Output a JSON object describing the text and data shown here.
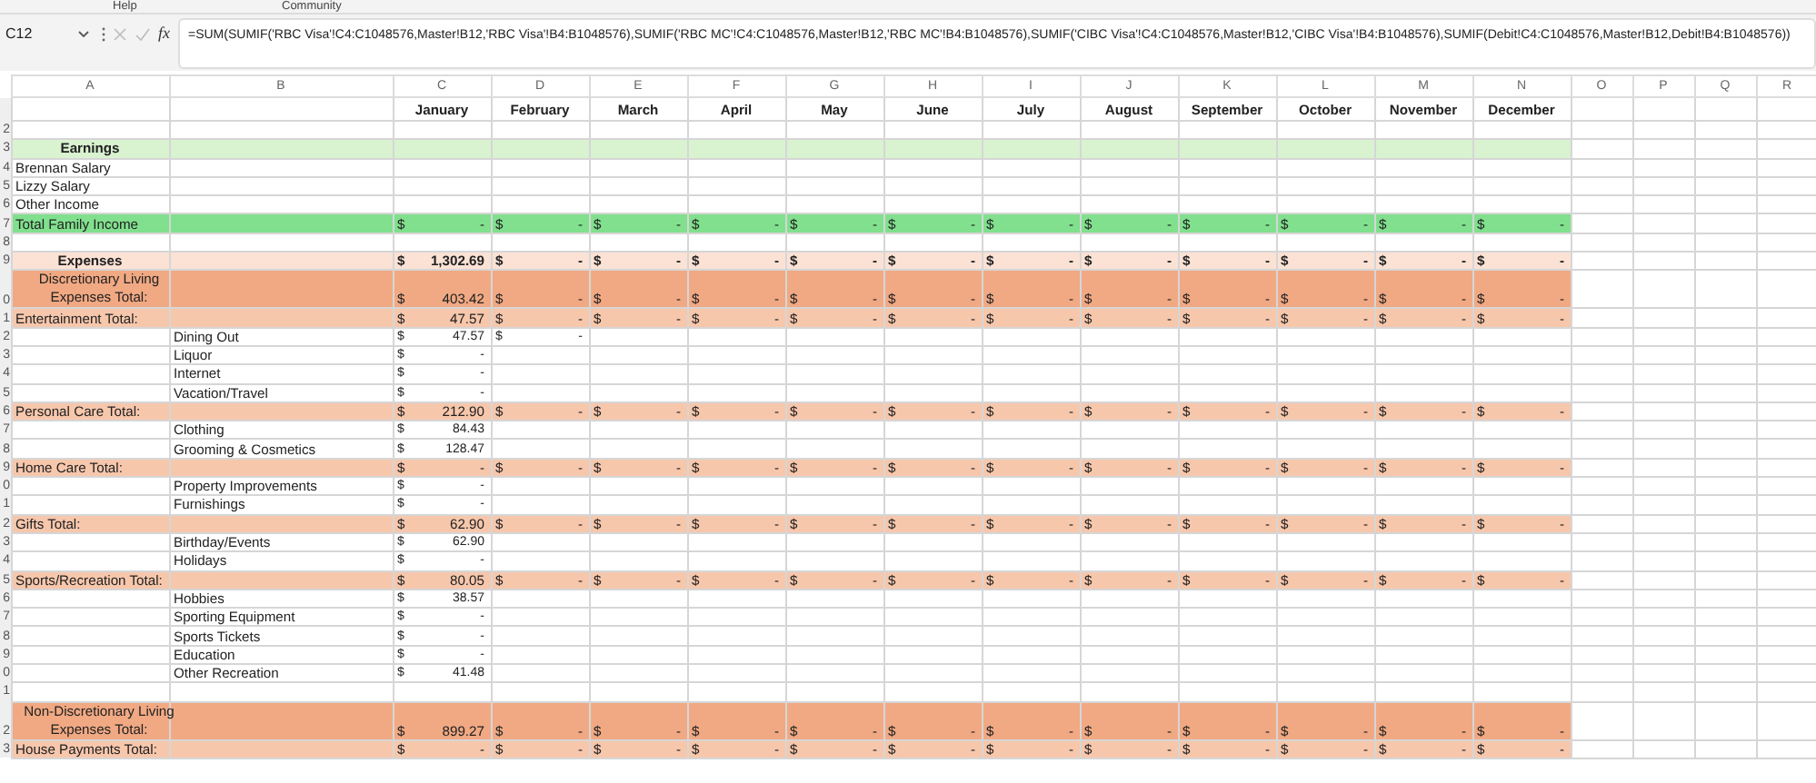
{
  "ribbon_tabs": [
    "Help",
    "Community"
  ],
  "formula_bar": {
    "name_box": "C12",
    "function_label": "fx",
    "formula": "=SUM(SUMIF('RBC Visa'!C4:C1048576,Master!B12,'RBC Visa'!B4:B1048576),SUMIF('RBC MC'!C4:C1048576,Master!B12,'RBC MC'!B4:B1048576),SUMIF('CIBC Visa'!C4:C1048576,Master!B12,'CIBC Visa'!B4:B1048576),SUMIF(Debit!C4:C1048576,Master!B12,Debit!B4:B1048576))"
  },
  "column_headers": [
    "A",
    "B",
    "C",
    "D",
    "E",
    "F",
    "G",
    "H",
    "I",
    "J",
    "K",
    "L",
    "M",
    "N",
    "O",
    "P",
    "Q",
    "R"
  ],
  "month_row": {
    "months": [
      "January",
      "February",
      "March",
      "April",
      "May",
      "June",
      "July",
      "August",
      "September",
      "October",
      "November",
      "December"
    ]
  },
  "rows": [
    {
      "row_number": "2",
      "kind": "blank"
    },
    {
      "row_number": "3",
      "kind": "earnings-header",
      "label": "Earnings"
    },
    {
      "row_number": "4",
      "kind": "income-item",
      "label": "Brennan Salary"
    },
    {
      "row_number": "5",
      "kind": "income-item",
      "label": "Lizzy Salary"
    },
    {
      "row_number": "6",
      "kind": "income-item",
      "label": "Other Income"
    },
    {
      "row_number": "7",
      "kind": "income-total",
      "label": "Total Family Income",
      "values": [
        [
          "$",
          "-"
        ],
        [
          "$",
          "-"
        ],
        [
          "$",
          "-"
        ],
        [
          "$",
          "-"
        ],
        [
          "$",
          "-"
        ],
        [
          "$",
          "-"
        ],
        [
          "$",
          "-"
        ],
        [
          "$",
          "-"
        ],
        [
          "$",
          "-"
        ],
        [
          "$",
          "-"
        ],
        [
          "$",
          "-"
        ],
        [
          "$",
          "-"
        ]
      ]
    },
    {
      "row_number": "8",
      "kind": "blank"
    },
    {
      "row_number": "9",
      "kind": "expenses-header",
      "label": "Expenses",
      "values": [
        [
          "$",
          "1,302.69"
        ],
        [
          "$",
          "-"
        ],
        [
          "$",
          "-"
        ],
        [
          "$",
          "-"
        ],
        [
          "$",
          "-"
        ],
        [
          "$",
          "-"
        ],
        [
          "$",
          "-"
        ],
        [
          "$",
          "-"
        ],
        [
          "$",
          "-"
        ],
        [
          "$",
          "-"
        ],
        [
          "$",
          "-"
        ],
        [
          "$",
          "-"
        ]
      ]
    },
    {
      "row_number": "0",
      "kind": "group-total",
      "label": "Discretionary Living Expenses Total:",
      "values": [
        [
          "$",
          "403.42"
        ],
        [
          "$",
          "-"
        ],
        [
          "$",
          "-"
        ],
        [
          "$",
          "-"
        ],
        [
          "$",
          "-"
        ],
        [
          "$",
          "-"
        ],
        [
          "$",
          "-"
        ],
        [
          "$",
          "-"
        ],
        [
          "$",
          "-"
        ],
        [
          "$",
          "-"
        ],
        [
          "$",
          "-"
        ],
        [
          "$",
          "-"
        ]
      ]
    },
    {
      "row_number": "1",
      "kind": "category-total",
      "label": "Entertainment Total:",
      "values": [
        [
          "$",
          "47.57"
        ],
        [
          "$",
          "-"
        ],
        [
          "$",
          "-"
        ],
        [
          "$",
          "-"
        ],
        [
          "$",
          "-"
        ],
        [
          "$",
          "-"
        ],
        [
          "$",
          "-"
        ],
        [
          "$",
          "-"
        ],
        [
          "$",
          "-"
        ],
        [
          "$",
          "-"
        ],
        [
          "$",
          "-"
        ],
        [
          "$",
          "-"
        ]
      ]
    },
    {
      "row_number": "2",
      "kind": "item",
      "label": "Dining Out",
      "values": [
        [
          "$",
          "47.57"
        ],
        [
          "$",
          "-"
        ]
      ]
    },
    {
      "row_number": "3",
      "kind": "item",
      "label": "Liquor",
      "values": [
        [
          "$",
          "-"
        ]
      ]
    },
    {
      "row_number": "4",
      "kind": "item",
      "label": "Internet",
      "values": [
        [
          "$",
          "-"
        ]
      ]
    },
    {
      "row_number": "5",
      "kind": "item",
      "label": "Vacation/Travel",
      "values": [
        [
          "$",
          "-"
        ]
      ]
    },
    {
      "row_number": "6",
      "kind": "category-total",
      "label": "Personal Care Total:",
      "values": [
        [
          "$",
          "212.90"
        ],
        [
          "$",
          "-"
        ],
        [
          "$",
          "-"
        ],
        [
          "$",
          "-"
        ],
        [
          "$",
          "-"
        ],
        [
          "$",
          "-"
        ],
        [
          "$",
          "-"
        ],
        [
          "$",
          "-"
        ],
        [
          "$",
          "-"
        ],
        [
          "$",
          "-"
        ],
        [
          "$",
          "-"
        ],
        [
          "$",
          "-"
        ]
      ]
    },
    {
      "row_number": "7",
      "kind": "item",
      "label": "Clothing",
      "values": [
        [
          "$",
          "84.43"
        ]
      ]
    },
    {
      "row_number": "8",
      "kind": "item",
      "label": "Grooming & Cosmetics",
      "values": [
        [
          "$",
          "128.47"
        ]
      ]
    },
    {
      "row_number": "9",
      "kind": "category-total",
      "label": "Home Care Total:",
      "values": [
        [
          "$",
          "-"
        ],
        [
          "$",
          "-"
        ],
        [
          "$",
          "-"
        ],
        [
          "$",
          "-"
        ],
        [
          "$",
          "-"
        ],
        [
          "$",
          "-"
        ],
        [
          "$",
          "-"
        ],
        [
          "$",
          "-"
        ],
        [
          "$",
          "-"
        ],
        [
          "$",
          "-"
        ],
        [
          "$",
          "-"
        ],
        [
          "$",
          "-"
        ]
      ]
    },
    {
      "row_number": "0",
      "kind": "item",
      "label": "Property Improvements",
      "values": [
        [
          "$",
          "-"
        ]
      ]
    },
    {
      "row_number": "1",
      "kind": "item",
      "label": "Furnishings",
      "values": [
        [
          "$",
          "-"
        ]
      ]
    },
    {
      "row_number": "2",
      "kind": "category-total",
      "label": "Gifts Total:",
      "values": [
        [
          "$",
          "62.90"
        ],
        [
          "$",
          "-"
        ],
        [
          "$",
          "-"
        ],
        [
          "$",
          "-"
        ],
        [
          "$",
          "-"
        ],
        [
          "$",
          "-"
        ],
        [
          "$",
          "-"
        ],
        [
          "$",
          "-"
        ],
        [
          "$",
          "-"
        ],
        [
          "$",
          "-"
        ],
        [
          "$",
          "-"
        ],
        [
          "$",
          "-"
        ]
      ]
    },
    {
      "row_number": "3",
      "kind": "item",
      "label": "Birthday/Events",
      "values": [
        [
          "$",
          "62.90"
        ]
      ]
    },
    {
      "row_number": "4",
      "kind": "item",
      "label": "Holidays",
      "values": [
        [
          "$",
          "-"
        ]
      ]
    },
    {
      "row_number": "5",
      "kind": "category-total",
      "label": "Sports/Recreation Total:",
      "values": [
        [
          "$",
          "80.05"
        ],
        [
          "$",
          "-"
        ],
        [
          "$",
          "-"
        ],
        [
          "$",
          "-"
        ],
        [
          "$",
          "-"
        ],
        [
          "$",
          "-"
        ],
        [
          "$",
          "-"
        ],
        [
          "$",
          "-"
        ],
        [
          "$",
          "-"
        ],
        [
          "$",
          "-"
        ],
        [
          "$",
          "-"
        ],
        [
          "$",
          "-"
        ]
      ]
    },
    {
      "row_number": "6",
      "kind": "item",
      "label": "Hobbies",
      "values": [
        [
          "$",
          "38.57"
        ]
      ]
    },
    {
      "row_number": "7",
      "kind": "item",
      "label": "Sporting Equipment",
      "values": [
        [
          "$",
          "-"
        ]
      ]
    },
    {
      "row_number": "8",
      "kind": "item",
      "label": "Sports Tickets",
      "values": [
        [
          "$",
          "-"
        ]
      ]
    },
    {
      "row_number": "9",
      "kind": "item",
      "label": "Education",
      "values": [
        [
          "$",
          "-"
        ]
      ]
    },
    {
      "row_number": "0",
      "kind": "item",
      "label": "Other Recreation",
      "values": [
        [
          "$",
          "41.48"
        ]
      ]
    },
    {
      "row_number": "1",
      "kind": "blank"
    },
    {
      "row_number": "2",
      "kind": "group-total",
      "label": "Non-Discretionary Living Expenses Total:",
      "values": [
        [
          "$",
          "899.27"
        ],
        [
          "$",
          "-"
        ],
        [
          "$",
          "-"
        ],
        [
          "$",
          "-"
        ],
        [
          "$",
          "-"
        ],
        [
          "$",
          "-"
        ],
        [
          "$",
          "-"
        ],
        [
          "$",
          "-"
        ],
        [
          "$",
          "-"
        ],
        [
          "$",
          "-"
        ],
        [
          "$",
          "-"
        ],
        [
          "$",
          "-"
        ]
      ]
    },
    {
      "row_number": "3",
      "kind": "category-total",
      "label": "House Payments Total:",
      "values": [
        [
          "$",
          "-"
        ],
        [
          "$",
          "-"
        ],
        [
          "$",
          "-"
        ],
        [
          "$",
          "-"
        ],
        [
          "$",
          "-"
        ],
        [
          "$",
          "-"
        ],
        [
          "$",
          "-"
        ],
        [
          "$",
          "-"
        ],
        [
          "$",
          "-"
        ],
        [
          "$",
          "-"
        ],
        [
          "$",
          "-"
        ],
        [
          "$",
          "-"
        ]
      ]
    }
  ]
}
